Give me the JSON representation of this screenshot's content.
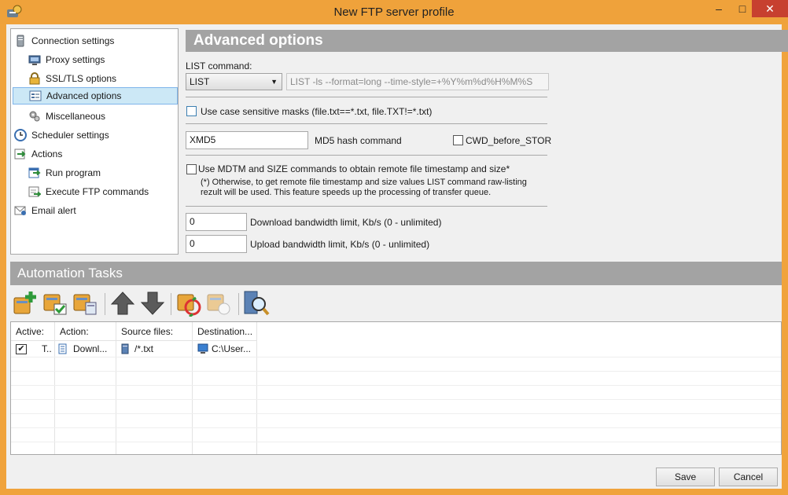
{
  "window": {
    "title": "New FTP server profile",
    "minimize": "–",
    "maximize": "□",
    "close": "✕"
  },
  "tree": {
    "items": [
      {
        "label": "Connection settings",
        "icon": "server-icon"
      },
      {
        "label": "Proxy settings",
        "icon": "proxy-icon"
      },
      {
        "label": "SSL/TLS options",
        "icon": "lock-icon"
      },
      {
        "label": "Advanced options",
        "icon": "settings-panel-icon"
      },
      {
        "label": "Miscellaneous",
        "icon": "gears-icon"
      },
      {
        "label": "Scheduler settings",
        "icon": "clock-icon"
      },
      {
        "label": "Actions",
        "icon": "arrow-icon"
      },
      {
        "label": "Run program",
        "icon": "run-icon"
      },
      {
        "label": "Execute FTP commands",
        "icon": "execute-icon"
      },
      {
        "label": "Email alert",
        "icon": "mail-icon"
      }
    ]
  },
  "advanced": {
    "header": "Advanced options",
    "list_label": "LIST command:",
    "list_value": "LIST",
    "list_placeholder": "LIST -ls --format=long --time-style=+%Y%m%d%H%M%S",
    "case_label": "Use case sensitive masks (file.txt==*.txt, file.TXT!=*.txt)",
    "md5_value": "XMD5",
    "md5_label": "MD5 hash command",
    "cwd_label": "CWD_before_STOR",
    "mdtm_label": "Use MDTM and SIZE commands to obtain remote file timestamp and size*",
    "note_line1": "(*) Otherwise, to get remote file timestamp and size values LIST command raw-listing",
    "note_line2": "rezult will be used. This feature speeds up the processing of transfer queue.",
    "download_value": "0",
    "download_label": "Download bandwidth limit, Kb/s (0 - unlimited)",
    "upload_value": "0",
    "upload_label": "Upload bandwidth limit, Kb/s (0 - unlimited)"
  },
  "automation": {
    "header": "Automation Tasks",
    "columns": [
      "Active:",
      "Action:",
      "Source files:",
      "Destination..."
    ],
    "rows": [
      {
        "active": "✔",
        "type": "T..",
        "action": "Downl...",
        "source": "/*.txt",
        "destination": "C:\\User..."
      }
    ]
  },
  "buttons": {
    "save": "Save",
    "cancel": "Cancel"
  }
}
